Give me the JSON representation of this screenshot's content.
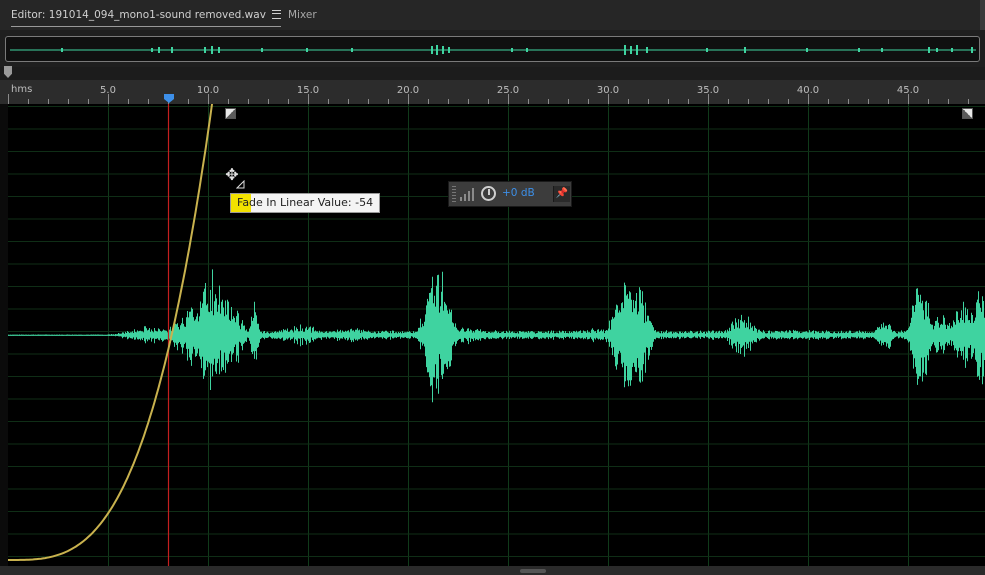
{
  "editor": {
    "tab_label": "Editor: 191014_094_mono1-sound removed.wav",
    "mixer_tab_label": "Mixer"
  },
  "ruler": {
    "unit_label": "hms",
    "tick_labels": [
      "5.0",
      "10.0",
      "15.0",
      "20.0",
      "25.0",
      "30.0",
      "35.0",
      "40.0",
      "45.0"
    ]
  },
  "tooltip": {
    "text": "Fade In Linear Value: -54"
  },
  "hud": {
    "gain_label": "+0 dB"
  },
  "colors": {
    "waveform": "#3fd3a0",
    "fade_curve": "#c9b24e",
    "playhead": "#c41f1f",
    "accent": "#3d8fe8"
  }
}
